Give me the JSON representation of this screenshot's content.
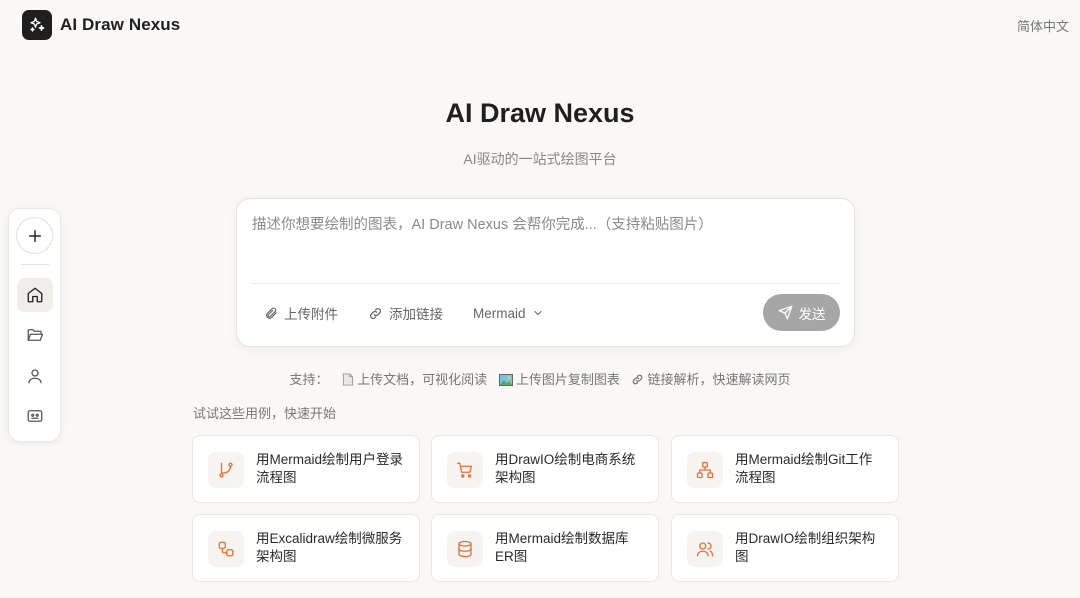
{
  "header": {
    "app_name": "AI Draw Nexus",
    "language": "简体中文"
  },
  "sidebar": {
    "items": [
      {
        "icon": "plus-icon",
        "label": "new"
      },
      {
        "icon": "home-icon",
        "label": "home",
        "active": true
      },
      {
        "icon": "folder-icon",
        "label": "projects"
      },
      {
        "icon": "user-icon",
        "label": "profile"
      },
      {
        "icon": "bot-icon",
        "label": "models"
      }
    ]
  },
  "hero": {
    "title": "AI Draw Nexus",
    "subtitle": "AI驱动的一站式绘图平台"
  },
  "prompt": {
    "placeholder": "描述你想要绘制的图表，AI Draw Nexus 会帮你完成...（支持粘贴图片）",
    "upload_label": "上传附件",
    "link_label": "添加链接",
    "engine_selected": "Mermaid",
    "send_label": "发送"
  },
  "supports": {
    "label": "支持：",
    "items": [
      "上传文档，可视化阅读",
      "上传图片复制图表",
      "链接解析，快速解读网页"
    ]
  },
  "examples": {
    "label": "试试这些用例，快速开始",
    "cards": [
      {
        "text": "用Mermaid绘制用户登录流程图",
        "icon": "git-branch-icon"
      },
      {
        "text": "用DrawIO绘制电商系统架构图",
        "icon": "cart-icon"
      },
      {
        "text": "用Mermaid绘制Git工作流程图",
        "icon": "network-icon"
      },
      {
        "text": "用Excalidraw绘制微服务架构图",
        "icon": "workflow-icon"
      },
      {
        "text": "用Mermaid绘制数据库ER图",
        "icon": "database-icon"
      },
      {
        "text": "用DrawIO绘制组织架构图",
        "icon": "users-icon"
      }
    ]
  },
  "colors": {
    "accent": "#e8703a",
    "send_disabled": "#a6a6a6",
    "background": "#f9f8f6"
  }
}
